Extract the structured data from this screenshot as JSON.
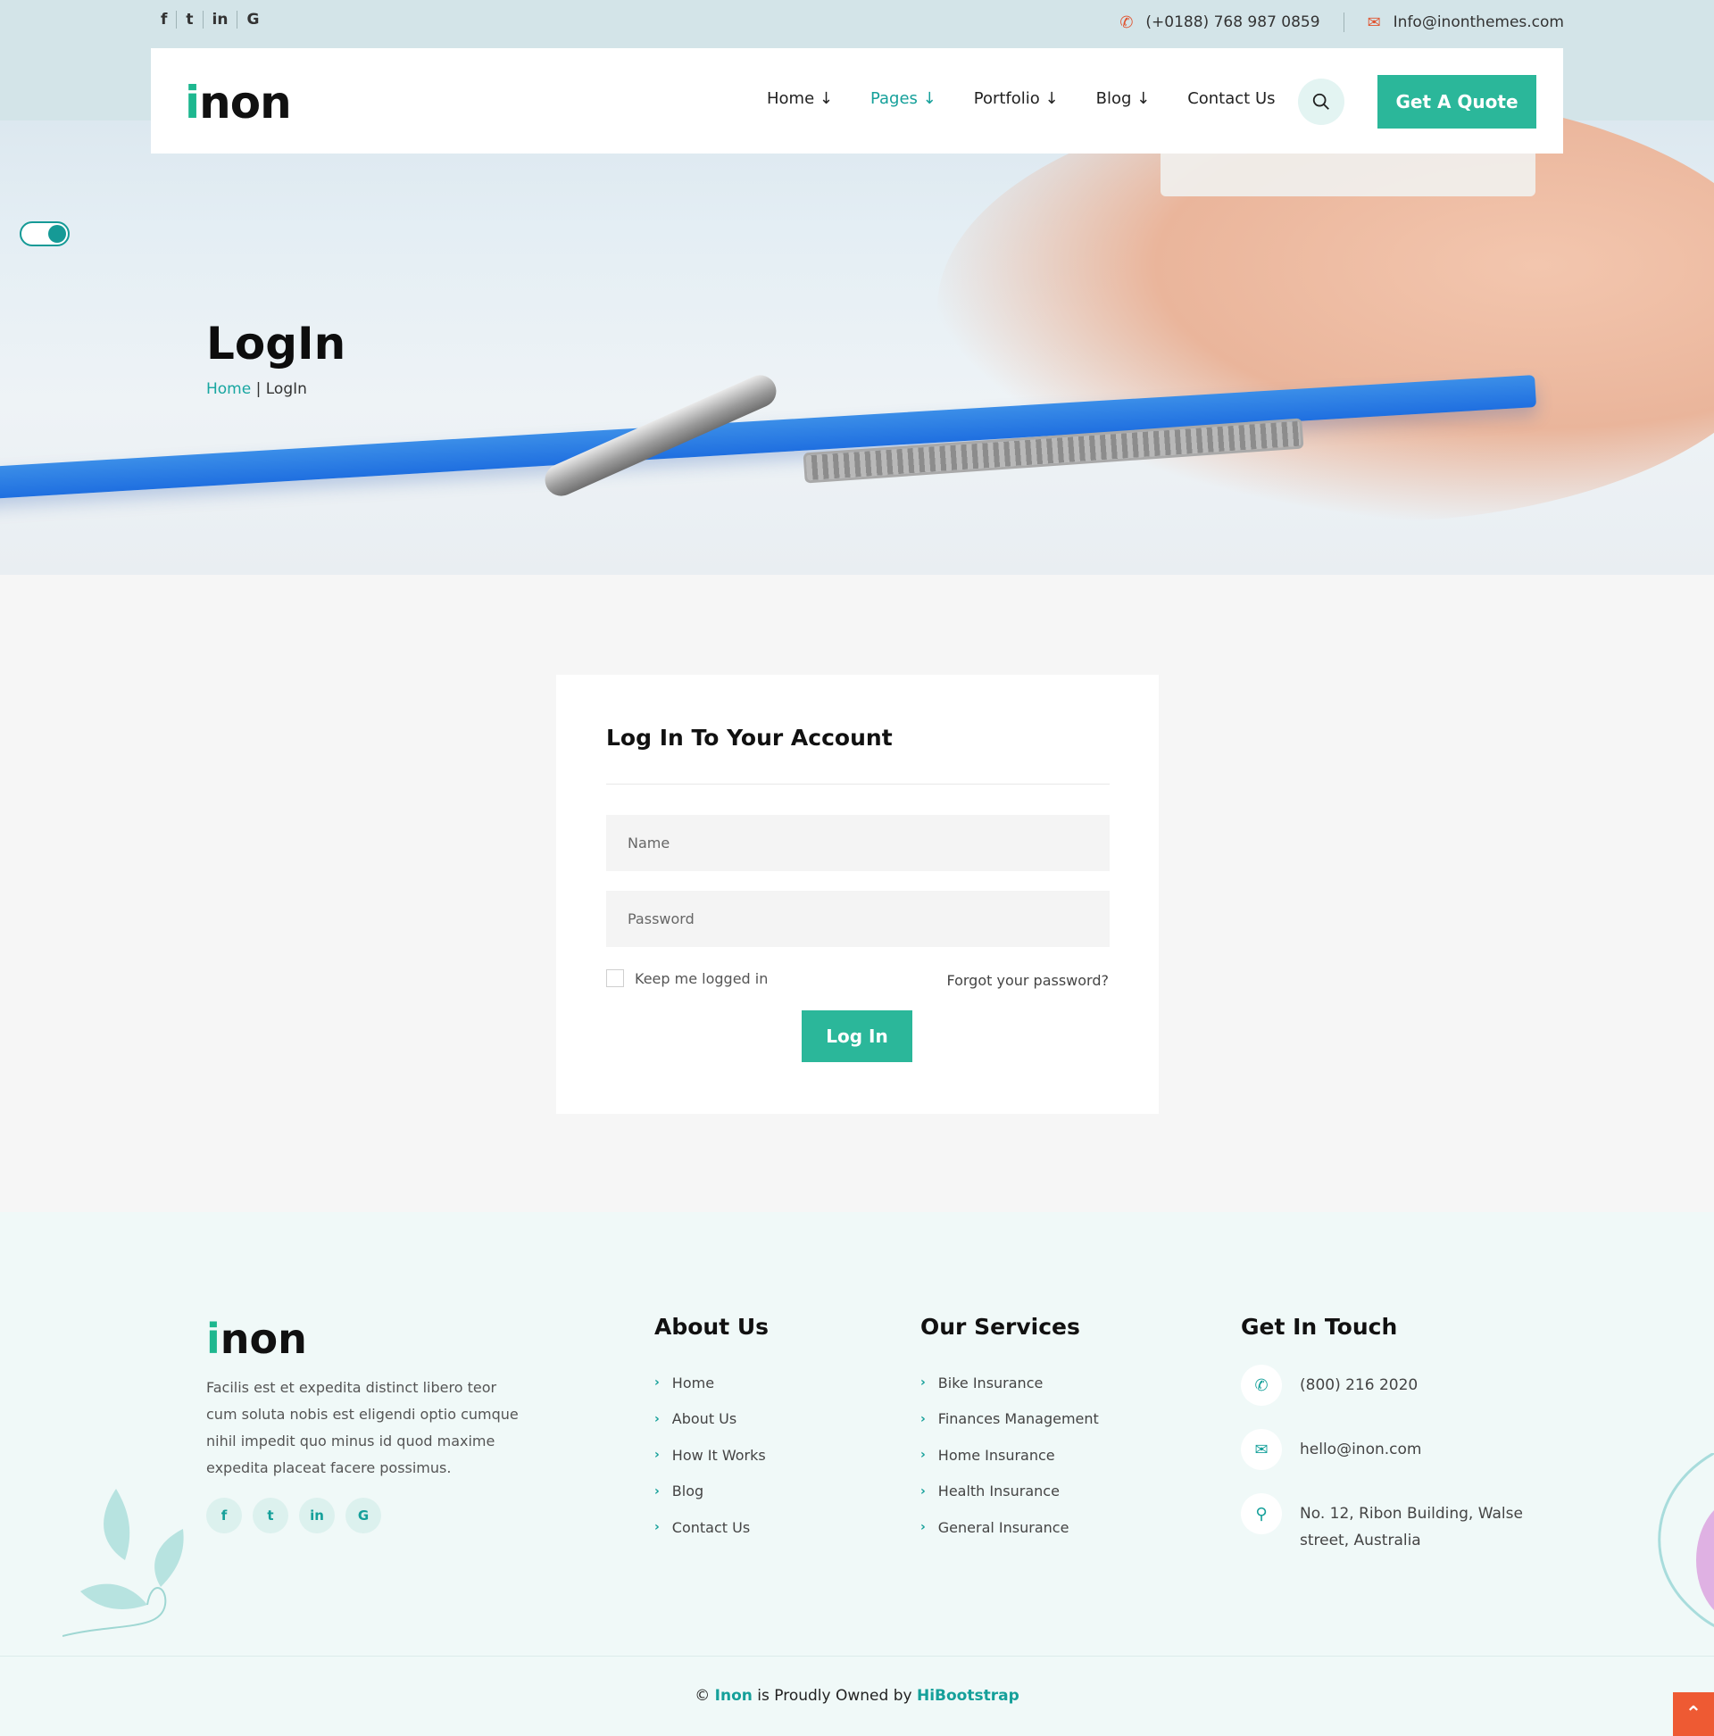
{
  "topbar": {
    "social": [
      "f",
      "t",
      "in",
      "G"
    ],
    "phone": "(+0188) 768 987 0859",
    "email": "Info@inonthemes.com"
  },
  "brand": {
    "logo_i": "i",
    "logo_rest": "non"
  },
  "nav": {
    "items": [
      {
        "label": "Home ↓"
      },
      {
        "label": "Pages ↓",
        "active": true
      },
      {
        "label": "Portfolio ↓"
      },
      {
        "label": "Blog ↓"
      },
      {
        "label": "Contact Us"
      }
    ],
    "search_icon": "search-icon",
    "quote_label": "Get A Quote"
  },
  "hero": {
    "title": "LogIn",
    "breadcrumb_home": "Home",
    "breadcrumb_sep": " | ",
    "breadcrumb_current": "LogIn"
  },
  "login": {
    "title": "Log In To Your Account",
    "name_placeholder": "Name",
    "password_placeholder": "Password",
    "keep_logged": "Keep me logged in",
    "forgot": "Forgot your password?",
    "button": "Log In"
  },
  "footer": {
    "about_text": "Facilis est et expedita distinct libero teor cum soluta nobis est eligendi optio cumque nihil impedit quo minus id quod maxime expedita placeat facere possimus.",
    "social": [
      "f",
      "t",
      "in",
      "G"
    ],
    "about_heading": "About Us",
    "about_links": [
      "Home",
      "About Us",
      "How It Works",
      "Blog",
      "Contact Us"
    ],
    "services_heading": "Our Services",
    "services_links": [
      "Bike Insurance",
      "Finances Management",
      "Home Insurance",
      "Health Insurance",
      "General Insurance"
    ],
    "touch_heading": "Get In Touch",
    "touch_phone": "(800) 216 2020",
    "touch_email": "hello@inon.com",
    "touch_address": "No. 12, Ribon Building, Walse street, Australia",
    "copyright_prefix": "©",
    "copyright_brand": "Inon",
    "copyright_mid": "is Proudly Owned by",
    "copyright_owner": "HiBootstrap"
  },
  "colors": {
    "accent": "#2bb79a",
    "teal_link": "#15a09a",
    "scroll_top": "#ee5a33"
  }
}
